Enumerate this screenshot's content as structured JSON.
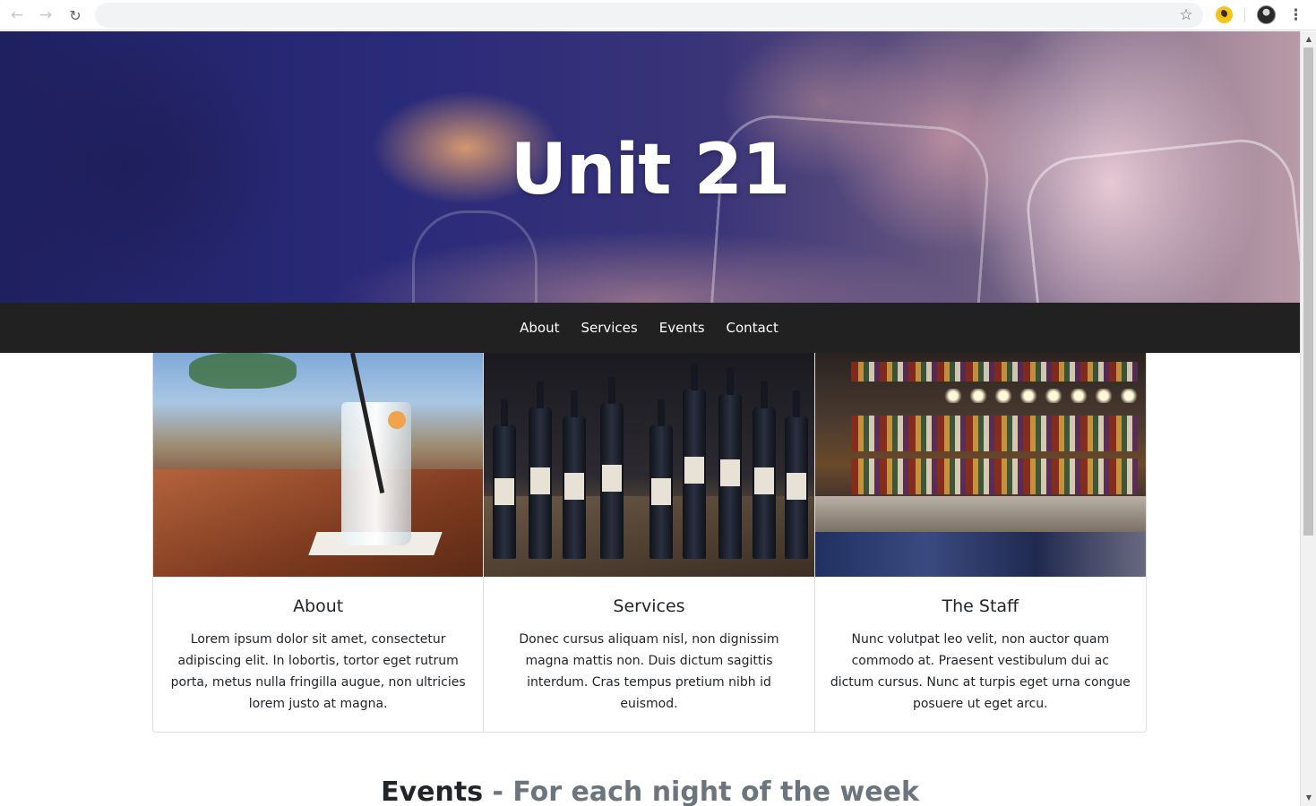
{
  "browser": {
    "address_value": "",
    "icons": [
      "back-arrow-icon",
      "forward-arrow-icon",
      "reload-icon",
      "star-icon",
      "moon-extension-icon",
      "profile-avatar",
      "kebab-menu-icon"
    ]
  },
  "hero": {
    "title": "Unit 21"
  },
  "navbar": {
    "items": [
      {
        "label": "About"
      },
      {
        "label": "Services"
      },
      {
        "label": "Events"
      },
      {
        "label": "Contact"
      }
    ],
    "background": "#212121"
  },
  "cards": [
    {
      "title": "About",
      "text": "Lorem ipsum dolor sit amet, consectetur adipiscing elit. In lobortis, tortor eget rutrum porta, metus nulla fringilla augue, non ultricies lorem justo at magna."
    },
    {
      "title": "Services",
      "text": "Donec cursus aliquam nisl, non dignissim magna mattis non. Duis dictum sagittis interdum. Cras tempus pretium nibh id euismod."
    },
    {
      "title": "The Staff",
      "text": "Nunc volutpat leo velit, non auctor quam commodo at. Praesent vestibulum dui ac dictum cursus. Nunc at turpis eget urna congue posuere ut eget arcu."
    }
  ],
  "events": {
    "heading": "Events",
    "separator": " - ",
    "subheading": "For each night of the week"
  },
  "colors": {
    "text": "#212529",
    "muted": "#6c757d"
  }
}
